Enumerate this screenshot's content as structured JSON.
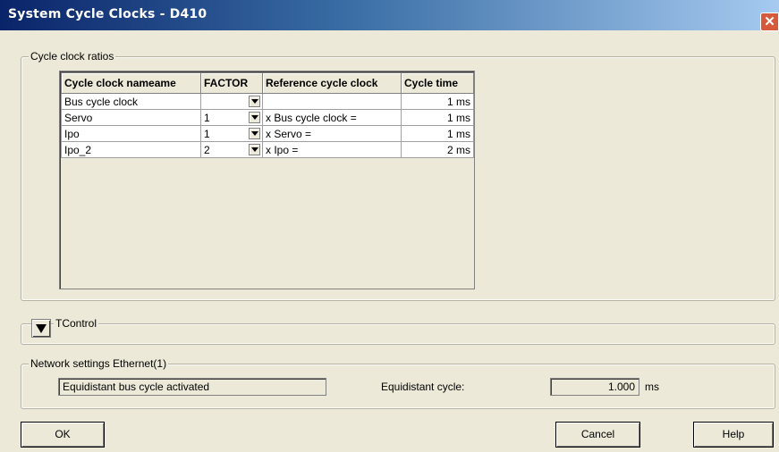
{
  "window": {
    "title": "System Cycle Clocks - D410",
    "close_symbol": "✕"
  },
  "cycle_ratios": {
    "legend": "Cycle clock ratios",
    "columns": [
      "Cycle clock nameame",
      "FACTOR",
      "Reference cycle clock",
      "Cycle time"
    ],
    "rows": [
      {
        "name": "Bus cycle clock",
        "factor": "",
        "reference": "",
        "cycle_time": "1 ms"
      },
      {
        "name": "Servo",
        "factor": "1",
        "reference": "x Bus cycle clock  =",
        "cycle_time": "1 ms"
      },
      {
        "name": "Ipo",
        "factor": "1",
        "reference": "x Servo =",
        "cycle_time": "1 ms"
      },
      {
        "name": "Ipo_2",
        "factor": "2",
        "reference": "x Ipo =",
        "cycle_time": "2 ms"
      }
    ]
  },
  "tcontrol": {
    "label": "TControl"
  },
  "network": {
    "legend": "Network settings Ethernet(1)",
    "status_text": "Equidistant bus cycle activated",
    "cycle_label": "Equidistant cycle:",
    "cycle_value": "1.000",
    "cycle_unit": "ms"
  },
  "buttons": {
    "ok": "OK",
    "cancel": "Cancel",
    "help": "Help"
  }
}
